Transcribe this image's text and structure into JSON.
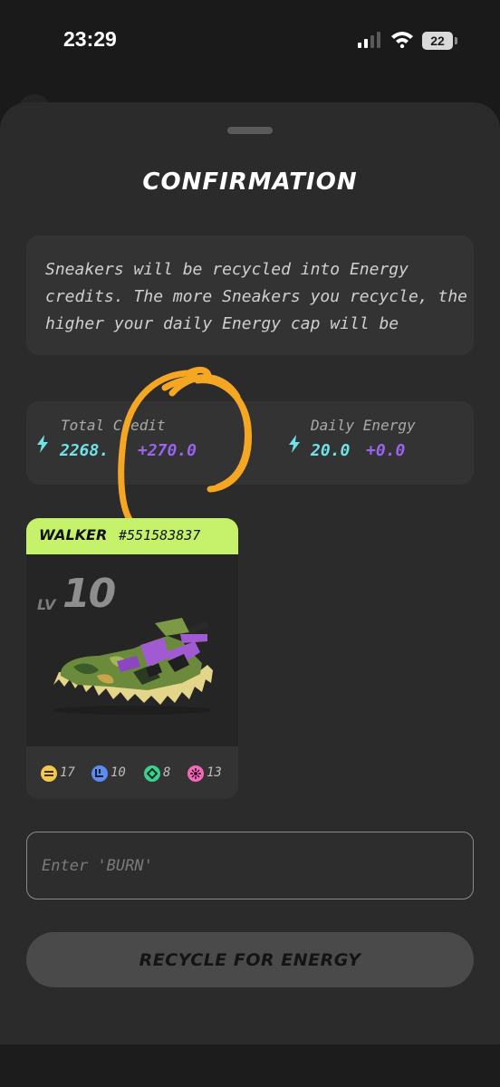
{
  "status_bar": {
    "time": "23:29",
    "battery": "22",
    "icons": [
      "signal-icon",
      "wifi-icon",
      "battery-icon"
    ]
  },
  "sheet": {
    "title": "CONFIRMATION",
    "info": "Sneakers will be recycled into Energy credits. The more Sneakers you recycle, the higher your daily Energy cap will be"
  },
  "stats": {
    "total_credit": {
      "label": "Total Credit",
      "value": "2268.",
      "delta": "+270.0"
    },
    "daily_energy": {
      "label": "Daily Energy",
      "value": "20.0",
      "delta": "+0.0"
    }
  },
  "sneaker": {
    "type": "WALKER",
    "id": "#551583837",
    "level_prefix": "LV",
    "level": "10",
    "attributes": [
      {
        "icon": "efficiency-icon",
        "value": "17",
        "color": "#f2c94c"
      },
      {
        "icon": "luck-icon",
        "value": "10",
        "color": "#5b8def"
      },
      {
        "icon": "comfort-icon",
        "value": "8",
        "color": "#3ecf8e"
      },
      {
        "icon": "resilience-icon",
        "value": "13",
        "color": "#f06ab8"
      }
    ]
  },
  "burn_input": {
    "placeholder": "Enter 'BURN'",
    "value": ""
  },
  "recycle_button": {
    "label": "RECYCLE FOR ENERGY"
  },
  "colors": {
    "accent_cyan": "#6fe3e8",
    "accent_purple": "#9a63f0",
    "card_header_green": "#c6f26b",
    "annotation_orange": "#f5a623"
  }
}
